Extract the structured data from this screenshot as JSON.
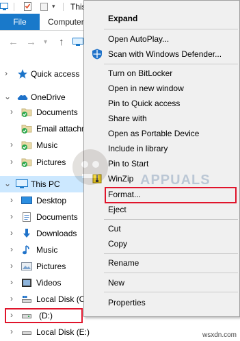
{
  "window": {
    "title": "This PC",
    "tabs": [
      "File",
      "Computer"
    ]
  },
  "nav": {
    "items": [
      {
        "label": "Quick access",
        "icon": "star-icon"
      },
      {
        "label": "OneDrive",
        "icon": "cloud-icon"
      },
      {
        "label": "Documents",
        "icon": "folder-synced-icon"
      },
      {
        "label": "Email attachm",
        "icon": "folder-synced-icon"
      },
      {
        "label": "Music",
        "icon": "folder-synced-icon"
      },
      {
        "label": "Pictures",
        "icon": "folder-synced-icon"
      },
      {
        "label": "This PC",
        "icon": "computer-icon"
      },
      {
        "label": "Desktop",
        "icon": "desktop-icon"
      },
      {
        "label": "Documents",
        "icon": "documents-icon"
      },
      {
        "label": "Downloads",
        "icon": "download-icon"
      },
      {
        "label": "Music",
        "icon": "music-icon"
      },
      {
        "label": "Pictures",
        "icon": "pictures-icon"
      },
      {
        "label": "Videos",
        "icon": "videos-icon"
      },
      {
        "label": "Local Disk (C:",
        "icon": "disk-icon"
      },
      {
        "label": "(D:)",
        "icon": "drive-icon"
      },
      {
        "label": "Local Disk (E:)",
        "icon": "disk-icon"
      }
    ]
  },
  "context_menu": {
    "items": [
      {
        "label": "Expand",
        "bold": true
      },
      {
        "label": "Open AutoPlay..."
      },
      {
        "label": "Scan with Windows Defender...",
        "icon": "defender-shield-icon"
      },
      {
        "label": "Turn on BitLocker"
      },
      {
        "label": "Open in new window"
      },
      {
        "label": "Pin to Quick access"
      },
      {
        "label": "Share with"
      },
      {
        "label": "Open as Portable Device"
      },
      {
        "label": "Include in library"
      },
      {
        "label": "Pin to Start"
      },
      {
        "label": "WinZip",
        "icon": "winzip-icon"
      },
      {
        "label": "Format..."
      },
      {
        "label": "Eject"
      },
      {
        "label": "Cut"
      },
      {
        "label": "Copy"
      },
      {
        "label": "Rename"
      },
      {
        "label": "New"
      },
      {
        "label": "Properties"
      }
    ]
  },
  "watermark": {
    "text": "APPUALS"
  },
  "footer": {
    "url": "wsxdn.com"
  },
  "colors": {
    "accent": "#1979ca",
    "highlight_box": "#e0142b",
    "selection": "#cce8ff",
    "menu_bg": "#f0f0f0"
  }
}
